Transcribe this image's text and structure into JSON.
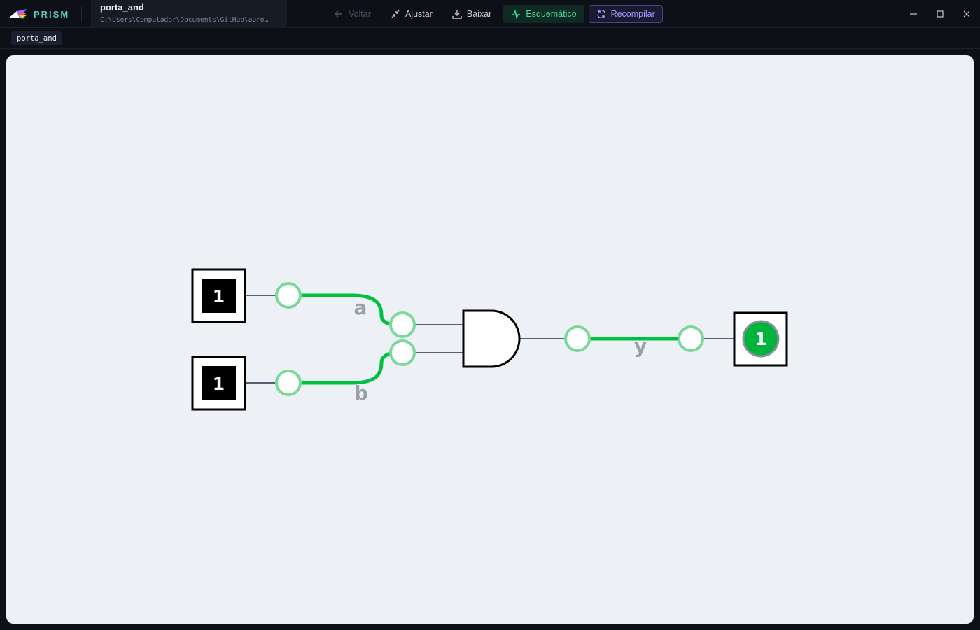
{
  "app": {
    "name": "PRISM",
    "brand_color": "#5ec8c2"
  },
  "file": {
    "name": "porta_and",
    "path": "C:\\Users\\Computador\\Documents\\GitHub\\auro…"
  },
  "toolbar": {
    "back_label": "Voltar",
    "fit_label": "Ajustar",
    "download_label": "Baixar",
    "schematic_label": "Esquemático",
    "recompile_label": "Recompilar"
  },
  "window_controls": [
    "minimize-icon",
    "maximize-icon",
    "close-icon"
  ],
  "module_chip": "porta_and",
  "schematic": {
    "inputs": [
      {
        "name": "a",
        "value": "1"
      },
      {
        "name": "b",
        "value": "1"
      }
    ],
    "gate": "AND",
    "output": {
      "name": "y",
      "value": "1"
    },
    "colors": {
      "active_wire": "#00c040",
      "port_ring": "#7ad99a",
      "neutral_wire": "#5b5f70",
      "output_led": "#00b33c"
    }
  }
}
